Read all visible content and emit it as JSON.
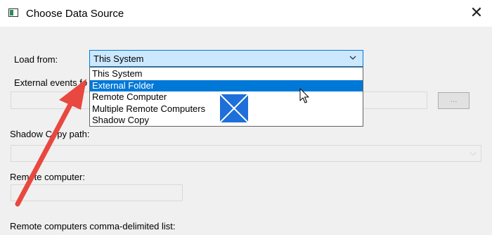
{
  "window": {
    "title": "Choose Data Source",
    "icon": "event-viewer-window-icon",
    "close_glyph": "✕"
  },
  "form": {
    "load_from_label": "Load from:",
    "load_from_selected": "This System",
    "external_events_label": "External events fo",
    "browse_label": "...",
    "shadow_copy_label": "Shadow Copy path:",
    "remote_computer_label": "Remote computer:",
    "remote_list_label": "Remote computers comma-delimited list:"
  },
  "dropdown": {
    "options": [
      "This System",
      "External Folder",
      "Remote Computer",
      "Multiple Remote Computers",
      "Shadow Copy"
    ],
    "highlighted_index": 1
  },
  "overlays": {
    "arrow_color": "#e8483f",
    "windows_logo_color": "#1e6fd9"
  }
}
